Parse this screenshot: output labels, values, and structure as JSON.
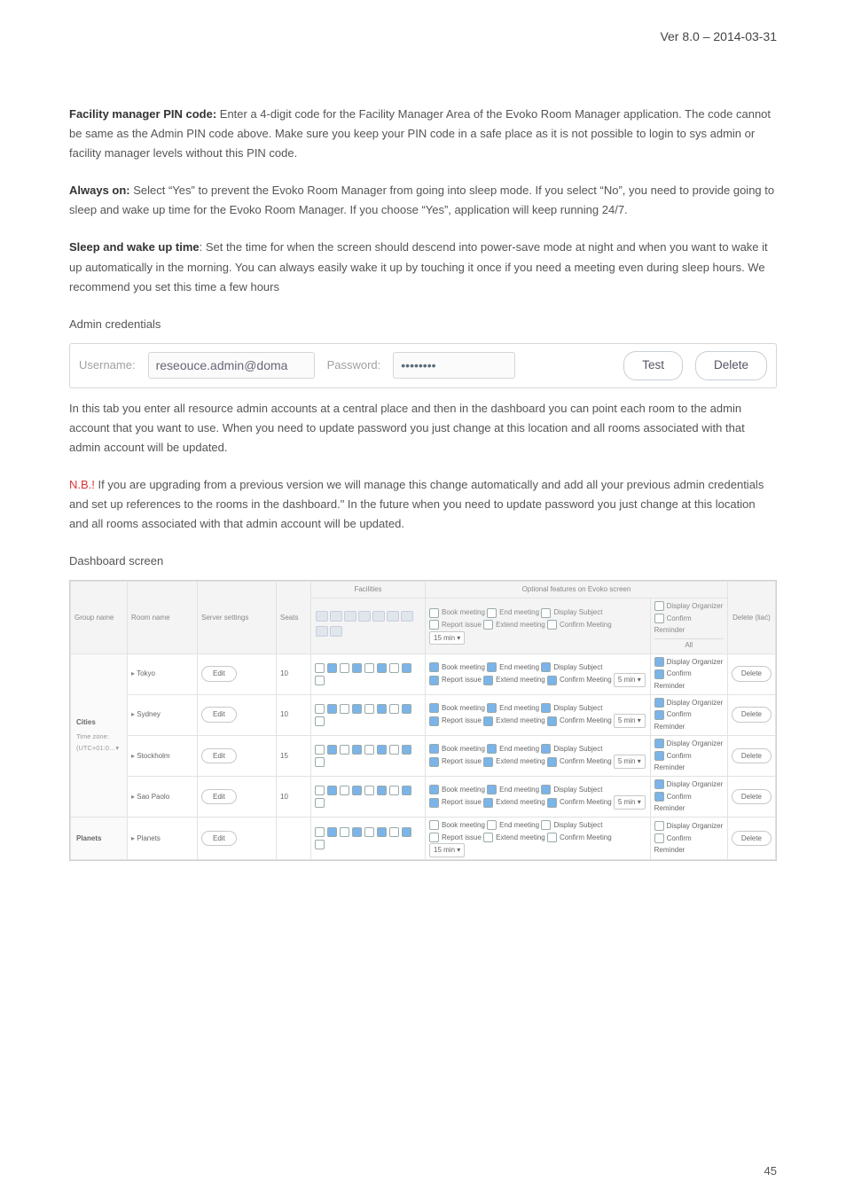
{
  "version": "Ver 8.0 – 2014-03-31",
  "para_pin": {
    "b": "Facility manager PIN code:",
    "t": " Enter a 4-digit code for the Facility Manager Area of the Evoko Room Manager application. The code cannot be same as the Admin PIN code above. Make sure you keep your PIN code in a safe place as it is not possible to login to sys admin or facility manager levels without this PIN code."
  },
  "para_always": {
    "b": "Always on:",
    "t": " Select “Yes” to prevent the Evoko Room Manager from going into sleep mode. If you select “No”, you need to provide going to sleep and wake up time for the Evoko Room Manager. If you choose “Yes”, application will keep running 24/7."
  },
  "para_sleep": {
    "b": "Sleep and wake up time",
    "t": ": Set the time for when the screen should descend into power-save mode at night and when you want to wake it up automatically in the morning. You can always easily wake it up by touching it once if you need a meeting even during sleep hours. We recommend you set this time a few hours"
  },
  "admin_creds_heading": "Admin credentials",
  "cred": {
    "un_label": "Username:",
    "un_value": "reseouce.admin@doma",
    "pw_label": "Password:",
    "pw_value": "••••••••",
    "test": "Test",
    "delete": "Delete"
  },
  "para_tab": "In this tab you enter all resource admin accounts at a central place and then in the dashboard you can point each room to the admin account that you want to use. When you need to update password you just change at this location and all rooms associated with that admin account will be updated.",
  "para_nb": {
    "nb": "N.B.!",
    "t": " If you are upgrading from a previous version we will manage this change automatically and add all your previous admin credentials and set up references to the rooms in the dashboard.\" In the future when you need to update password you just change at this location and all rooms associated with that admin account will be updated."
  },
  "dashboard_heading": "Dashboard screen",
  "dash": {
    "cols": {
      "group": "Group name",
      "room": "Room name",
      "server": "Server settings",
      "seats": "Seats",
      "facilities": "Facilities",
      "optional": "Optional features on Evoko screen",
      "delete": "Delete (liać)"
    },
    "opt_labels": {
      "book": "Book meeting",
      "end": "End meeting",
      "subj": "Display Subject",
      "org": "Display Organizer",
      "report": "Report issue",
      "extend": "Extend meeting",
      "confirm": "Confirm Meeting",
      "confrem": "Confirm Reminder",
      "min5": "5 min ▾",
      "min15": "15 min ▾",
      "all": "All"
    },
    "groups": [
      {
        "name": "Cities",
        "tz": "Time zone: (UTC+01:0…▾"
      },
      {
        "name": "Planets"
      }
    ],
    "rows": [
      {
        "group": 0,
        "arrow": "▸",
        "room": "Tokyo",
        "seats": "10"
      },
      {
        "group": 0,
        "arrow": "▸",
        "room": "Sydney",
        "seats": "10"
      },
      {
        "group": 0,
        "arrow": "▸",
        "room": "Stockholm",
        "seats": "15"
      },
      {
        "group": 0,
        "arrow": "▸",
        "room": "Sao Paolo",
        "seats": "10"
      },
      {
        "group": 1,
        "arrow": "▸",
        "room": "Planets",
        "seats": ""
      }
    ],
    "edit": "Edit",
    "delete_btn": "Delete"
  },
  "page_number": "45"
}
